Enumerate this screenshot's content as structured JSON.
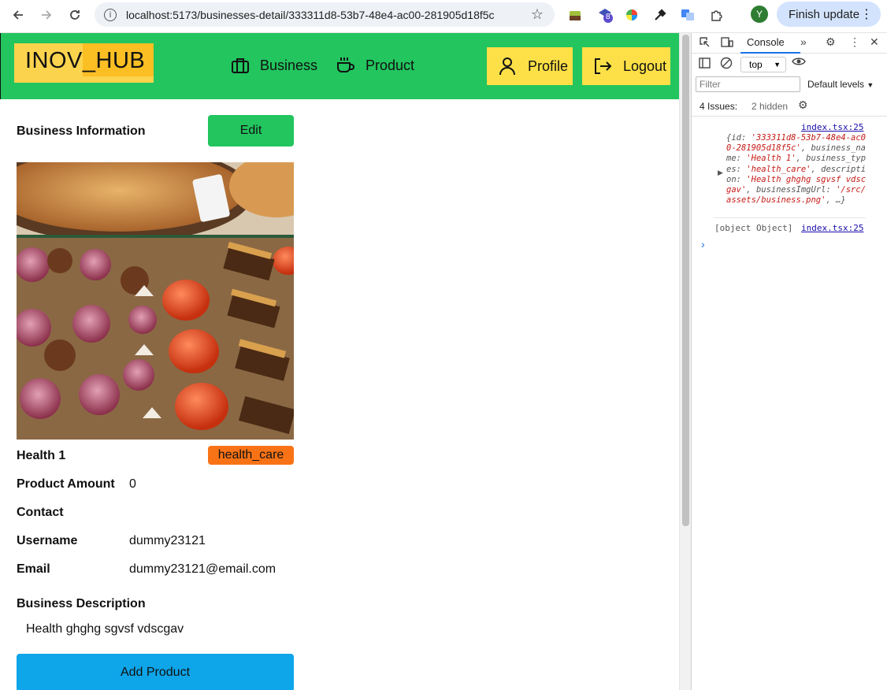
{
  "browser": {
    "url": "localhost:5173/businesses-detail/333311d8-53b7-48e4-ac00-281905d18f5c",
    "profile_initial": "Y",
    "finish_update_label": "Finish update",
    "extension_badge": "8"
  },
  "header": {
    "logo": "INOV_HUB",
    "nav": [
      {
        "label": "Business",
        "icon": "briefcase-icon"
      },
      {
        "label": "Product",
        "icon": "coffee-cup-icon"
      }
    ],
    "profile_label": "Profile",
    "logout_label": "Logout",
    "colors": {
      "header_bg": "#22c55e",
      "button_bg": "#fde047",
      "logo_bg": "#fcd34d"
    }
  },
  "business": {
    "section_title": "Business Information",
    "edit_label": "Edit",
    "name": "Health 1",
    "type_tag": "health_care",
    "product_amount_label": "Product Amount",
    "product_amount": "0",
    "contact_label": "Contact",
    "username_label": "Username",
    "username": "dummy23121",
    "email_label": "Email",
    "email": "dummy23121@email.com",
    "description_label": "Business Description",
    "description": "Health ghghg sgvsf vdscgav",
    "add_product_label": "Add Product"
  },
  "devtools": {
    "tab": "Console",
    "context": "top",
    "filter_placeholder": "Filter",
    "levels": "Default levels",
    "issues": "4 Issues:",
    "hidden": "2 hidden",
    "log1_source": "index.tsx:25",
    "log1_text_pre": "{id: ",
    "log1_id": "'333311d8-53b7-48e4-ac00-281905d18f5c'",
    "log1_mid1": ", business_name: ",
    "log1_name": "'Health 1'",
    "log1_mid2": ", business_types: ",
    "log1_types": "'health_care'",
    "log1_mid3": ", description: ",
    "log1_desc": "'Health ghghg sgvsf vdscgav'",
    "log1_mid4": ", businessImgUrl: ",
    "log1_img": "'/src/assets/business.png'",
    "log1_end": ", …}",
    "log2_text": "[object Object]",
    "log2_source": "index.tsx:25"
  }
}
